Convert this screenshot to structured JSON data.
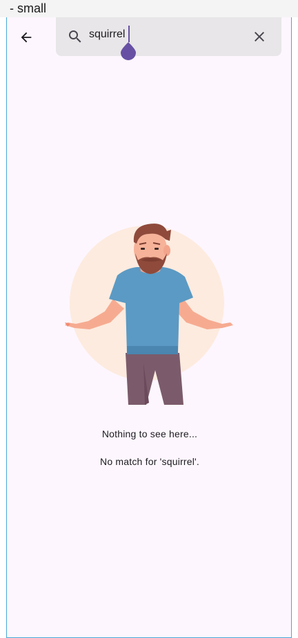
{
  "window": {
    "caption": "- small"
  },
  "search": {
    "query": "squirrel",
    "back_icon": "arrow-back-icon",
    "search_icon": "search-icon",
    "clear_icon": "close-icon"
  },
  "empty_state": {
    "illustration": "shrugging-man-illustration",
    "title": "Nothing to see here...",
    "message": "No match for 'squirrel'."
  },
  "colors": {
    "background": "#fdf6fe",
    "search_bar": "#e8e6e8",
    "accent": "#6750a4",
    "frame_border": "#46a8d8"
  }
}
